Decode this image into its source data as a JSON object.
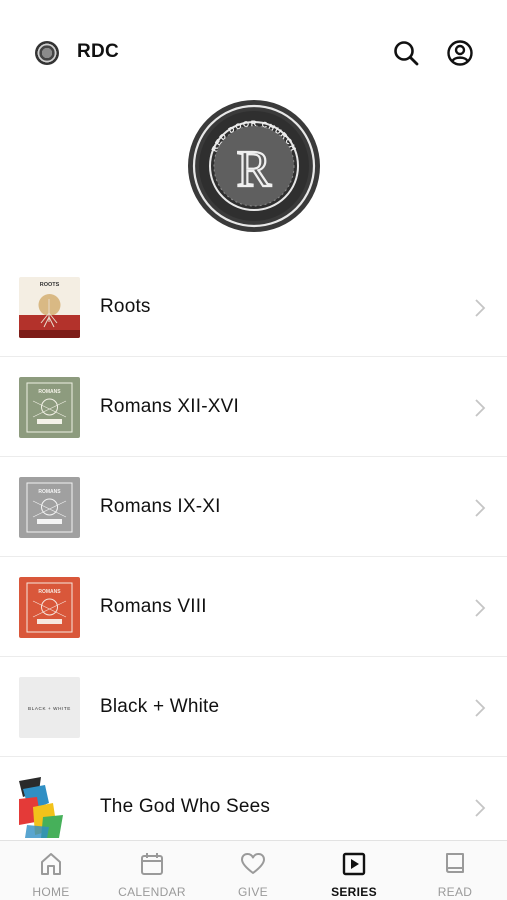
{
  "status_bar": {
    "time": ""
  },
  "header": {
    "title": "RDC",
    "search_icon": "search-icon",
    "profile_icon": "profile-icon"
  },
  "hero": {
    "logo_text": "RED DOOR CHURCH",
    "logo_letter": "R"
  },
  "series": [
    {
      "title": "Roots",
      "thumb_caption": "ROOTS",
      "thumb_style": "roots",
      "colors": [
        "#f3ece0",
        "#b3322b"
      ]
    },
    {
      "title": "Romans XII-XVI",
      "thumb_caption": "ROMANS",
      "thumb_style": "romans",
      "colors": [
        "#8d9b7e",
        "#f2f0e6"
      ]
    },
    {
      "title": "Romans IX-XI",
      "thumb_caption": "ROMANS",
      "thumb_style": "romans",
      "colors": [
        "#9d9d9d",
        "#f2f2f2"
      ]
    },
    {
      "title": "Romans VIII",
      "thumb_caption": "ROMANS",
      "thumb_style": "romans",
      "colors": [
        "#d9573a",
        "#f5e6df"
      ]
    },
    {
      "title": "Black + White",
      "thumb_caption": "BLACK + WHITE",
      "thumb_style": "blackwhite",
      "colors": [
        "#ececec",
        "#333333"
      ]
    },
    {
      "title": "The God Who Sees",
      "thumb_caption": "",
      "thumb_style": "godwhosees",
      "colors": [
        "#ffffff",
        "#2f8fc4"
      ]
    }
  ],
  "tabs": [
    {
      "label": "HOME",
      "icon": "home-icon",
      "active": false
    },
    {
      "label": "CALENDAR",
      "icon": "calendar-icon",
      "active": false
    },
    {
      "label": "GIVE",
      "icon": "heart-icon",
      "active": false
    },
    {
      "label": "SERIES",
      "icon": "play-square-icon",
      "active": true
    },
    {
      "label": "READ",
      "icon": "book-icon",
      "active": false
    }
  ]
}
